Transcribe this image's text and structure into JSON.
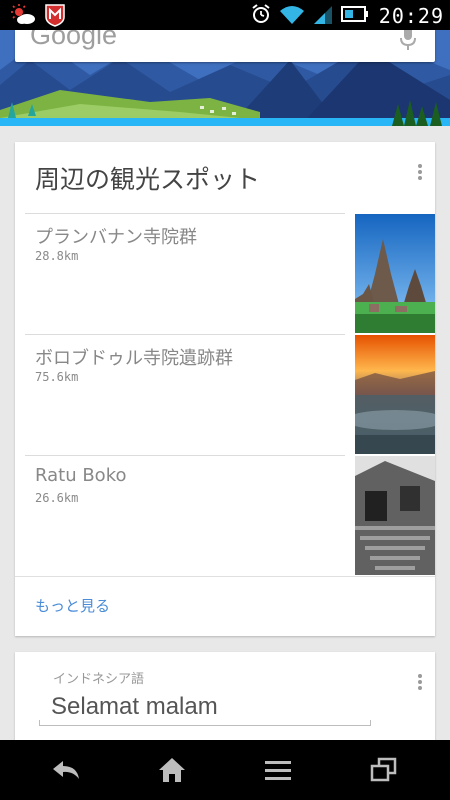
{
  "status_bar": {
    "time": "20:29",
    "icons": [
      "weather-icon",
      "mcafee-icon",
      "alarm-icon",
      "wifi-icon",
      "signal-icon",
      "battery-icon"
    ]
  },
  "search": {
    "logo_text": "Google",
    "icons": [
      "mic-icon"
    ]
  },
  "places_card": {
    "title": "周辺の観光スポット",
    "items": [
      {
        "name": "プランバナン寺院群",
        "distance": "28.8km",
        "thumbnail": "temple-photo"
      },
      {
        "name": "ボロブドゥル寺院遺跡群",
        "distance": "75.6km",
        "thumbnail": "sunrise-photo"
      },
      {
        "name": "Ratu Boko",
        "distance": "26.6km",
        "thumbnail": "ruins-photo"
      }
    ],
    "more_label": "もっと見る",
    "colors": {
      "link": "#4a8cd8"
    }
  },
  "translate_card": {
    "language_label": "インドネシア語",
    "phrase": "Selamat malam"
  },
  "nav_bar": {
    "buttons": [
      "back-icon",
      "home-icon",
      "menu-icon",
      "recent-apps-icon"
    ]
  }
}
